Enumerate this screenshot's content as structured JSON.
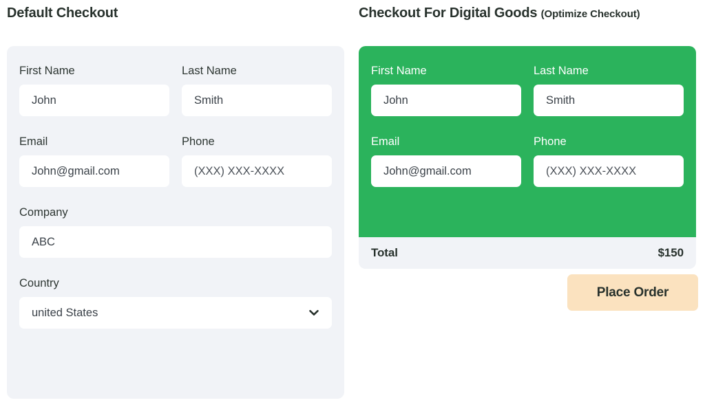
{
  "columns": {
    "left": {
      "heading": "Default Checkout"
    },
    "right": {
      "heading": "Checkout For Digital Goods",
      "heading_suffix": "(Optimize Checkout)"
    }
  },
  "default_checkout": {
    "fields": {
      "first_name": {
        "label": "First Name",
        "value": "John",
        "placeholder": "First Name"
      },
      "last_name": {
        "label": "Last Name",
        "value": "Smith",
        "placeholder": "Last Name"
      },
      "email": {
        "label": "Email",
        "value": "John@gmail.com",
        "placeholder": "Email"
      },
      "phone": {
        "label": "Phone",
        "value": "",
        "placeholder": "(XXX) XXX-XXXX"
      },
      "company": {
        "label": "Company",
        "value": "ABC",
        "placeholder": "Company"
      },
      "country": {
        "label": "Country",
        "value": "united States",
        "placeholder": "Country",
        "options": [
          "united States"
        ]
      }
    }
  },
  "optimized_checkout": {
    "fields": {
      "first_name": {
        "label": "First Name",
        "value": "John",
        "placeholder": "First Name"
      },
      "last_name": {
        "label": "Last Name",
        "value": "Smith",
        "placeholder": "Last Name"
      },
      "email": {
        "label": "Email",
        "value": "John@gmail.com",
        "placeholder": "Email"
      },
      "phone": {
        "label": "Phone",
        "value": "",
        "placeholder": "(XXX) XXX-XXXX"
      }
    },
    "summary": {
      "total_label": "Total",
      "total_amount": "$150"
    },
    "place_order_label": "Place Order"
  },
  "colors": {
    "card_background": "#f1f3f7",
    "green_card": "#2bb35c",
    "place_order_background": "#fbe2bf",
    "text_primary": "#27312c",
    "input_background": "#ffffff"
  },
  "icons": {
    "chevron_down": "chevron-down-icon"
  }
}
